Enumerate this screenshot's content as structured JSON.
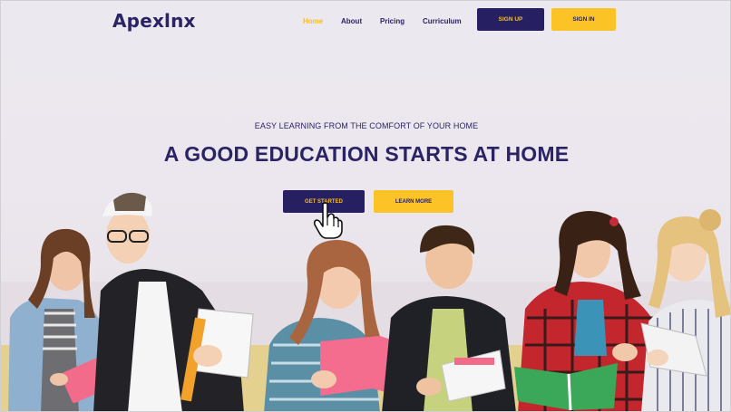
{
  "brand": {
    "name": "Apexlnx"
  },
  "nav": {
    "items": [
      {
        "label": "Home",
        "active": true
      },
      {
        "label": "About",
        "active": false
      },
      {
        "label": "Pricing",
        "active": false
      },
      {
        "label": "Curriculum",
        "active": false
      }
    ]
  },
  "auth": {
    "signup_label": "SIGN UP",
    "signin_label": "SIGN IN"
  },
  "hero": {
    "eyebrow": "EASY LEARNING FROM THE COMFORT OF YOUR HOME",
    "headline": "A GOOD EDUCATION STARTS AT HOME",
    "primary_cta": "GET STARTED",
    "secondary_cta": "LEARN MORE"
  },
  "colors": {
    "primary": "#262063",
    "accent": "#fbc325",
    "background": "#ebe8ef"
  },
  "icons": {
    "cursor": "hand-pointer-icon"
  }
}
